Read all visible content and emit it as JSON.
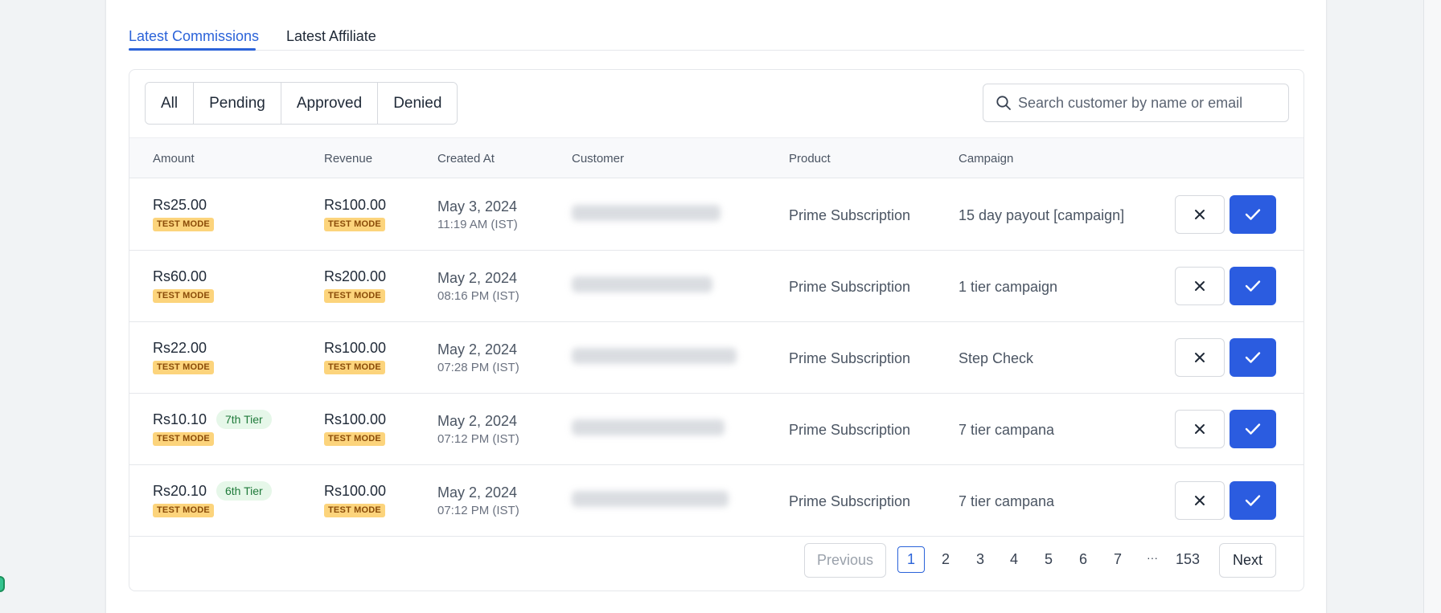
{
  "tabs": [
    {
      "label": "Latest Commissions",
      "active": true
    },
    {
      "label": "Latest Affiliate",
      "active": false
    }
  ],
  "filters": [
    "All",
    "Pending",
    "Approved",
    "Denied"
  ],
  "search": {
    "placeholder": "Search customer by name or email",
    "value": ""
  },
  "columns": [
    "Amount",
    "Revenue",
    "Created At",
    "Customer",
    "Product",
    "Campaign"
  ],
  "rows": [
    {
      "amount": "Rs25.00",
      "tier": "",
      "amount_badge": "TEST MODE",
      "revenue": "Rs100.00",
      "revenue_badge": "TEST MODE",
      "date": "May 3, 2024",
      "time": "11:19 AM (IST)",
      "product": "Prime Subscription",
      "campaign": "15 day payout [campaign]"
    },
    {
      "amount": "Rs60.00",
      "tier": "",
      "amount_badge": "TEST MODE",
      "revenue": "Rs200.00",
      "revenue_badge": "TEST MODE",
      "date": "May 2, 2024",
      "time": "08:16 PM (IST)",
      "product": "Prime Subscription",
      "campaign": "1 tier campaign"
    },
    {
      "amount": "Rs22.00",
      "tier": "",
      "amount_badge": "TEST MODE",
      "revenue": "Rs100.00",
      "revenue_badge": "TEST MODE",
      "date": "May 2, 2024",
      "time": "07:28 PM (IST)",
      "product": "Prime Subscription",
      "campaign": "Step Check"
    },
    {
      "amount": "Rs10.10",
      "tier": "7th Tier",
      "amount_badge": "TEST MODE",
      "revenue": "Rs100.00",
      "revenue_badge": "TEST MODE",
      "date": "May 2, 2024",
      "time": "07:12 PM (IST)",
      "product": "Prime Subscription",
      "campaign": "7 tier campana"
    },
    {
      "amount": "Rs20.10",
      "tier": "6th Tier",
      "amount_badge": "TEST MODE",
      "revenue": "Rs100.00",
      "revenue_badge": "TEST MODE",
      "date": "May 2, 2024",
      "time": "07:12 PM (IST)",
      "product": "Prime Subscription",
      "campaign": "7 tier campana"
    }
  ],
  "pagination": {
    "previous_label": "Previous",
    "next_label": "Next",
    "pages": [
      "1",
      "2",
      "3",
      "4",
      "5",
      "6",
      "7",
      "···",
      "153"
    ],
    "current": "1"
  },
  "colors": {
    "accent": "#2b63d9",
    "approve": "#2b5ce0",
    "test_badge": "#fcd47c",
    "tier_badge": "#e6f7e9"
  },
  "icons": {
    "search": "search-icon",
    "deny": "close-icon",
    "approve": "check-icon"
  }
}
